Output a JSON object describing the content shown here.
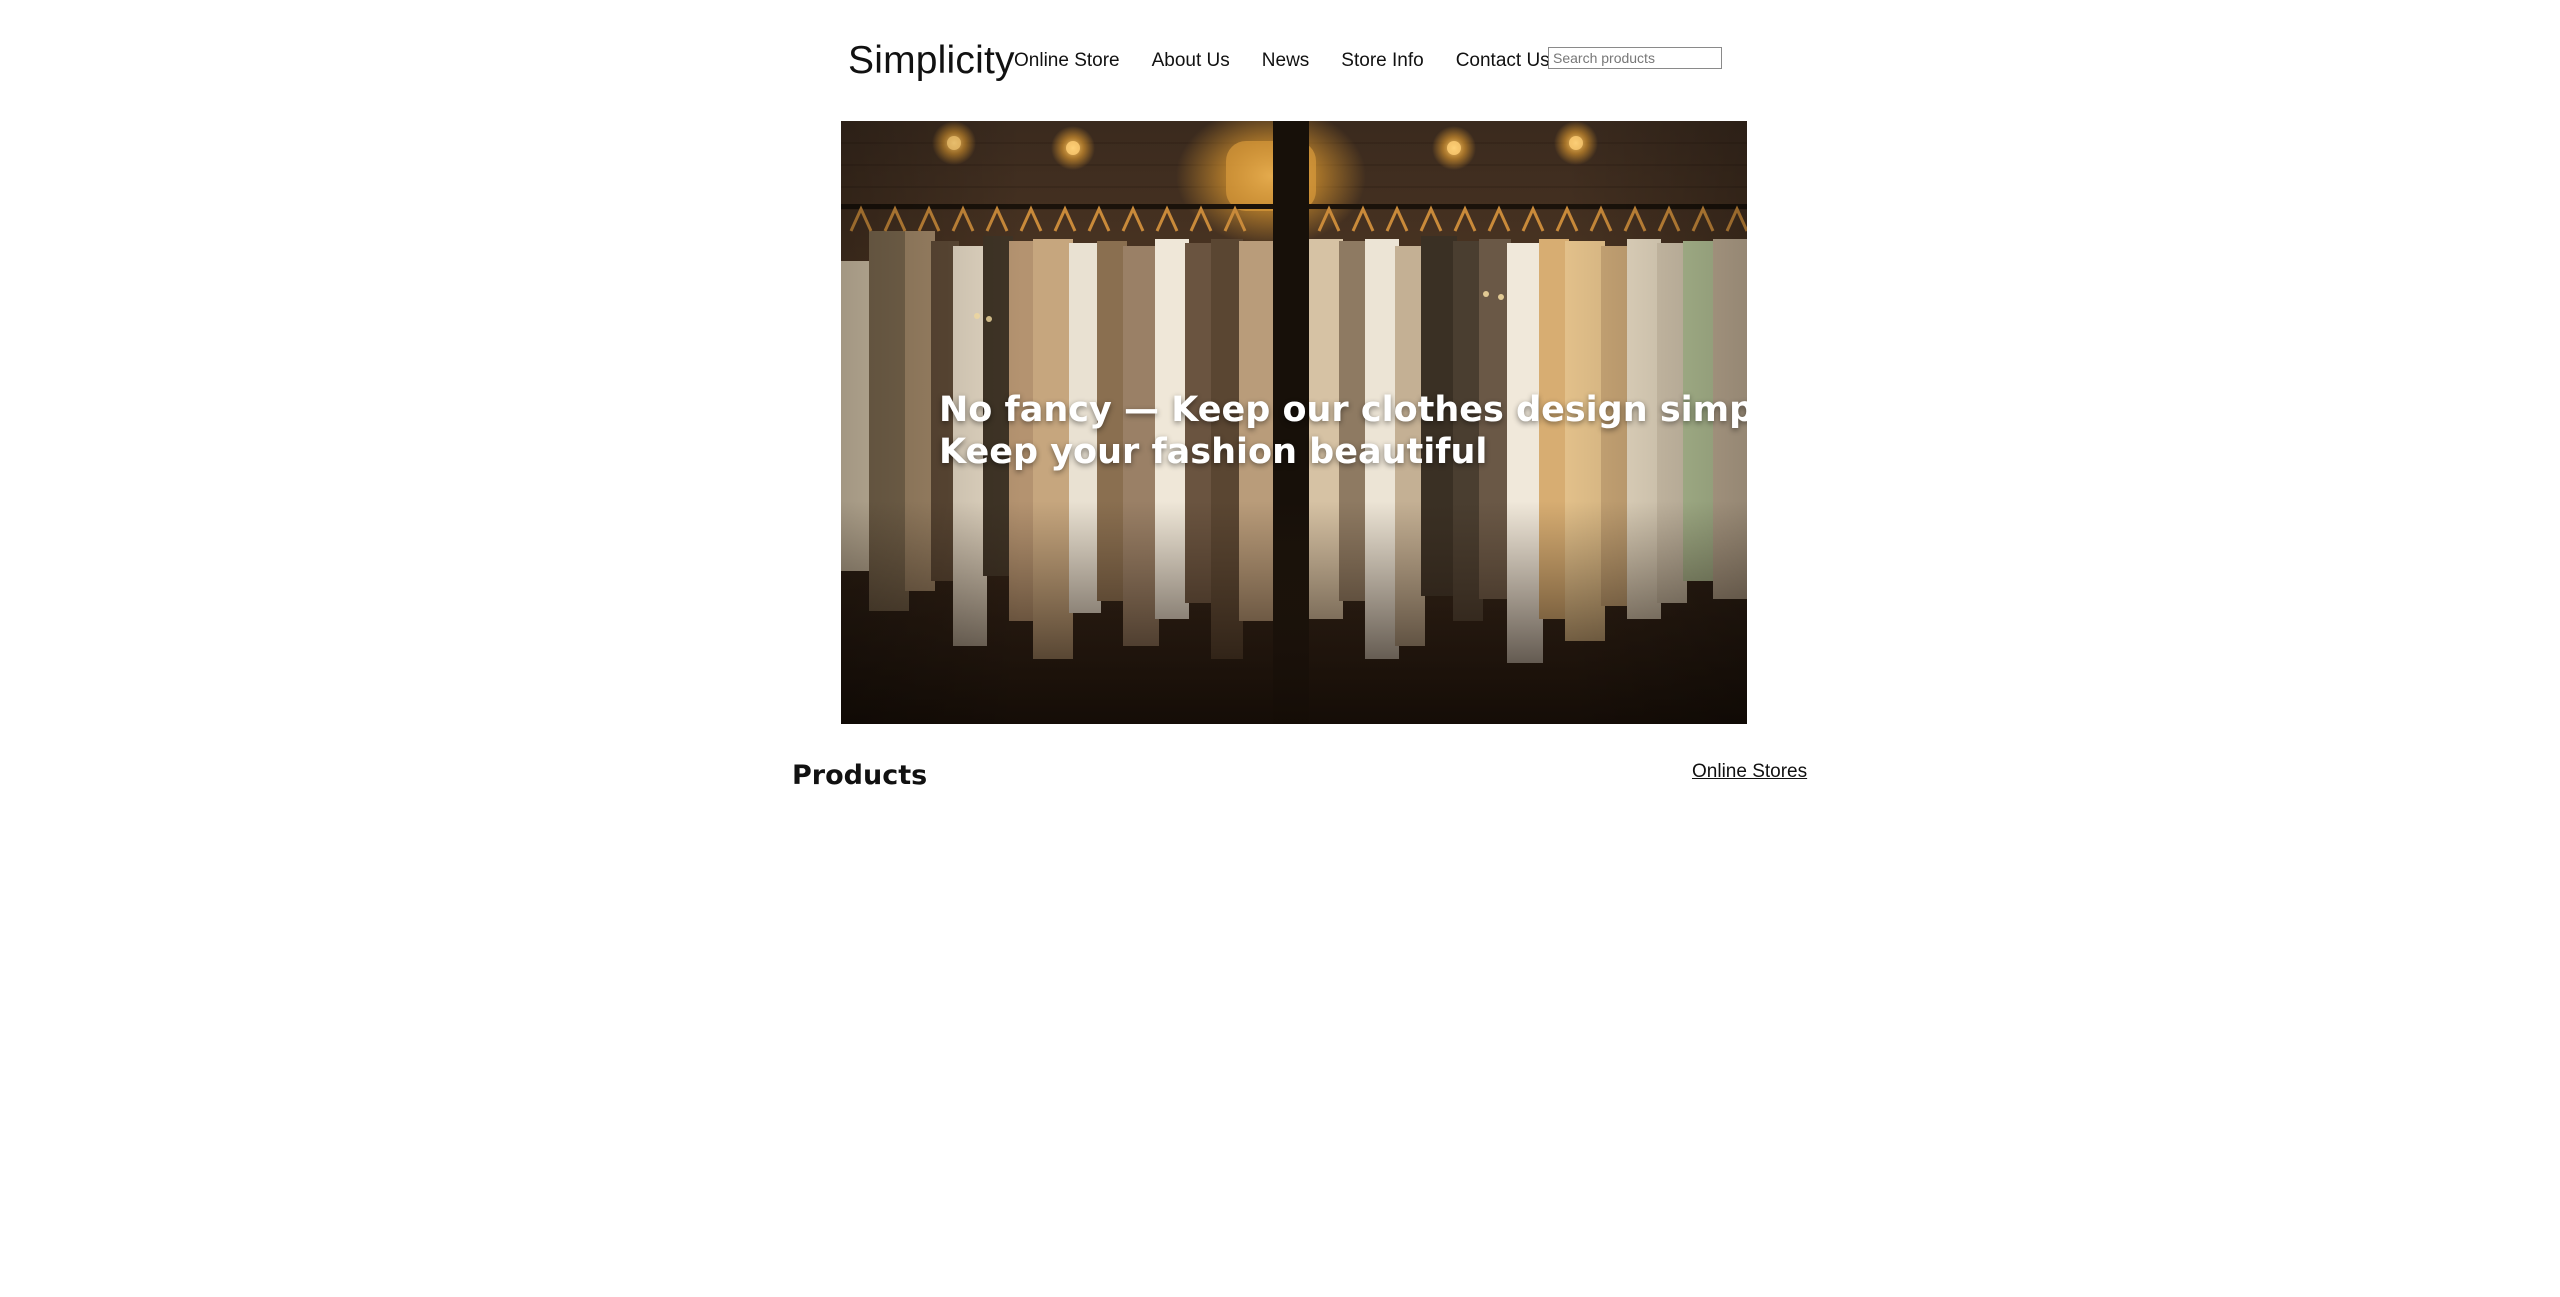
{
  "header": {
    "brand": "Simplicity",
    "nav": [
      {
        "label": "Online Store"
      },
      {
        "label": "About Us"
      },
      {
        "label": "News"
      },
      {
        "label": "Store Info"
      },
      {
        "label": "Contact Us"
      }
    ],
    "search": {
      "placeholder": "Search products",
      "value": ""
    }
  },
  "hero": {
    "line1": "No fancy — Keep our clothes design simple,",
    "line2": "Keep your fashion beautiful",
    "image": "clothing-rack-photo"
  },
  "products": {
    "heading": "Products",
    "link_label": "Online Stores"
  }
}
